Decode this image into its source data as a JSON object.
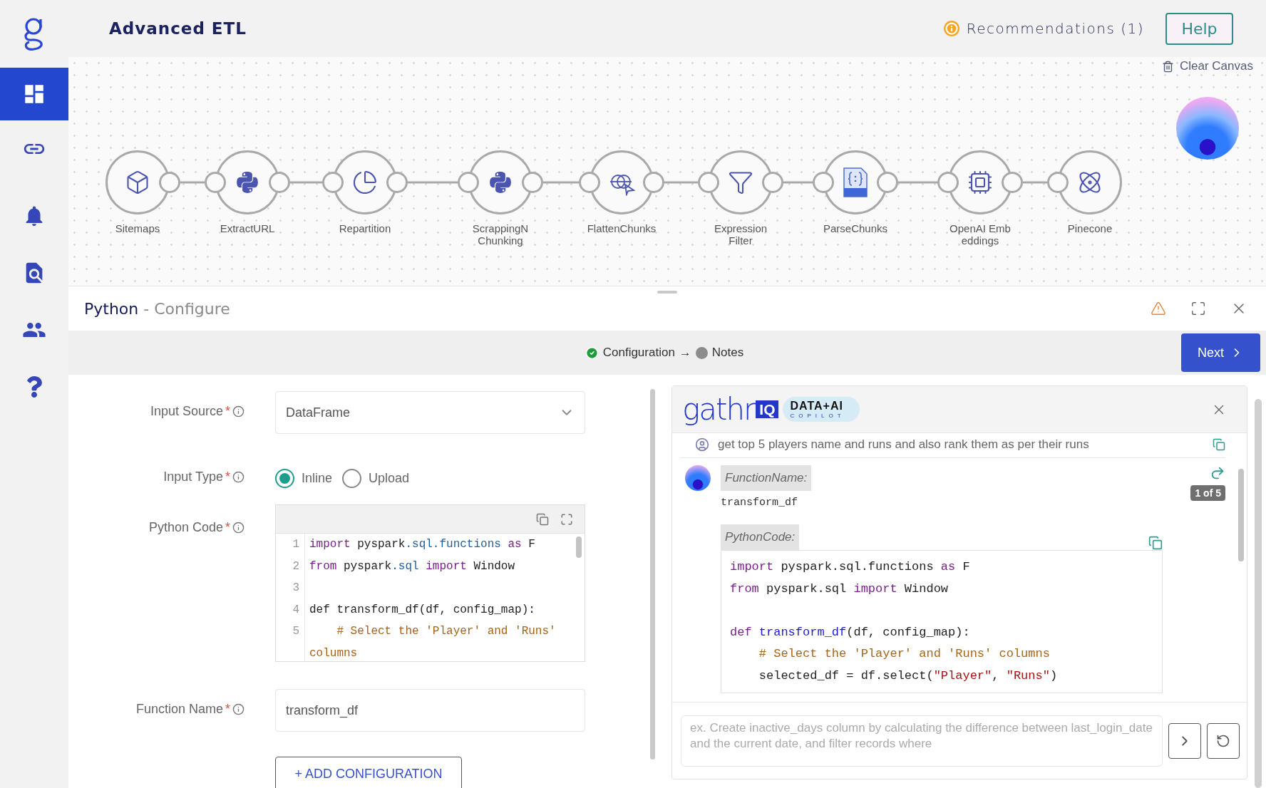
{
  "app": {
    "title": "Advanced ETL"
  },
  "header": {
    "recommendations": "Recommendations (1)",
    "help": "Help"
  },
  "sidebar": {
    "items": [
      {
        "kind": "dashboard",
        "selected": true
      },
      {
        "kind": "link",
        "selected": false
      },
      {
        "kind": "bell",
        "selected": false
      },
      {
        "kind": "search-doc",
        "selected": false
      },
      {
        "kind": "people",
        "selected": false
      },
      {
        "kind": "help",
        "selected": false
      }
    ]
  },
  "canvas": {
    "clear": "Clear Canvas",
    "nodes": [
      {
        "label": "Sitemaps",
        "kind": "box"
      },
      {
        "label": "ExtractURL",
        "kind": "python"
      },
      {
        "label": "Repartition",
        "kind": "pie"
      },
      {
        "label": "ScrappingN\nChunking",
        "kind": "python"
      },
      {
        "label": "FlattenChunks",
        "kind": "flatten"
      },
      {
        "label": "Expression\nFilter",
        "kind": "filter"
      },
      {
        "label": "ParseChunks",
        "kind": "json"
      },
      {
        "label": "OpenAI Emb\neddings",
        "kind": "chip"
      },
      {
        "label": "Pinecone",
        "kind": "cluster"
      }
    ]
  },
  "panel": {
    "title": "Python",
    "subtitle": "- Configure",
    "steps": [
      {
        "label": "Configuration",
        "done": true
      },
      {
        "label": "Notes",
        "done": false
      }
    ],
    "separator": "→",
    "next": "Next"
  },
  "form": {
    "fields": [
      {
        "kind": "select",
        "label": "Input Source",
        "required_mark": "*",
        "value": "DataFrame"
      },
      {
        "kind": "radio",
        "label": "Input Type",
        "required_mark": "*",
        "options": [
          {
            "label": "Inline",
            "selected": true
          },
          {
            "label": "Upload",
            "selected": false
          }
        ]
      },
      {
        "kind": "code",
        "label": "Python Code",
        "required_mark": "*",
        "lines": [
          {
            "number": "1",
            "tokens": [
              {
                "kind": "keyword",
                "text": "import"
              },
              {
                "kind": "plain",
                "text": " pyspark"
              },
              {
                "kind": "property",
                "text": ".sql.functions "
              },
              {
                "kind": "keyword",
                "text": "as"
              },
              {
                "kind": "plain",
                "text": " F"
              }
            ]
          },
          {
            "number": "2",
            "tokens": [
              {
                "kind": "keyword",
                "text": "from"
              },
              {
                "kind": "plain",
                "text": " pyspark"
              },
              {
                "kind": "property",
                "text": ".sql "
              },
              {
                "kind": "keyword",
                "text": "import"
              },
              {
                "kind": "plain",
                "text": " Window"
              }
            ]
          },
          {
            "number": "3"
          },
          {
            "number": "4",
            "tokens": [
              {
                "kind": "plain",
                "text": "def transform_df(df, config_map):"
              }
            ]
          },
          {
            "number": "5",
            "tokens": [
              {
                "kind": "comment",
                "text": "    # Select the 'Player' and 'Runs' columns"
              }
            ]
          }
        ]
      },
      {
        "kind": "text",
        "label": "Function Name",
        "required_mark": "*",
        "value": "transform_df"
      }
    ],
    "add_button": "+ ADD CONFIGURATION"
  },
  "copilot": {
    "logo": {
      "word": "gathr",
      "badge": "IQ",
      "tag": "DATA+AI",
      "sub": "COPILOT"
    },
    "previous_prompt": "get top 5 players name and runs and also rank them as per their runs",
    "response": {
      "function_label": "FunctionName:",
      "function_name": "transform_df",
      "counter": "1 of 5",
      "code_label": "PythonCode:",
      "code": [
        {
          "kind": "code",
          "tokens": [
            {
              "kind": "keyword",
              "text": "import"
            },
            {
              "kind": "plain",
              "text": " pyspark.sql.functions "
            },
            {
              "kind": "keyword",
              "text": "as"
            },
            {
              "kind": "plain",
              "text": " F"
            }
          ]
        },
        {
          "kind": "code",
          "tokens": [
            {
              "kind": "keyword",
              "text": "from"
            },
            {
              "kind": "plain",
              "text": " pyspark.sql "
            },
            {
              "kind": "keyword",
              "text": "import"
            },
            {
              "kind": "plain",
              "text": " Window"
            }
          ]
        },
        {
          "kind": "blank"
        },
        {
          "kind": "code",
          "tokens": [
            {
              "kind": "keyword",
              "text": "def "
            },
            {
              "kind": "def",
              "text": "transform_df"
            },
            {
              "kind": "plain",
              "text": "(df, config_map):"
            }
          ]
        },
        {
          "kind": "code",
          "tokens": [
            {
              "kind": "comment",
              "text": "    # Select the 'Player' and 'Runs' columns"
            }
          ]
        },
        {
          "kind": "code",
          "tokens": [
            {
              "kind": "plain",
              "text": "    selected_df = df.select("
            },
            {
              "kind": "string",
              "text": "\"Player\""
            },
            {
              "kind": "plain",
              "text": ", "
            },
            {
              "kind": "string",
              "text": "\"Runs\""
            },
            {
              "kind": "plain",
              "text": ")"
            }
          ]
        }
      ]
    },
    "input": {
      "placeholder": "ex. Create inactive_days column by calculating the difference between last_login_date and the current date, and filter records where"
    }
  }
}
